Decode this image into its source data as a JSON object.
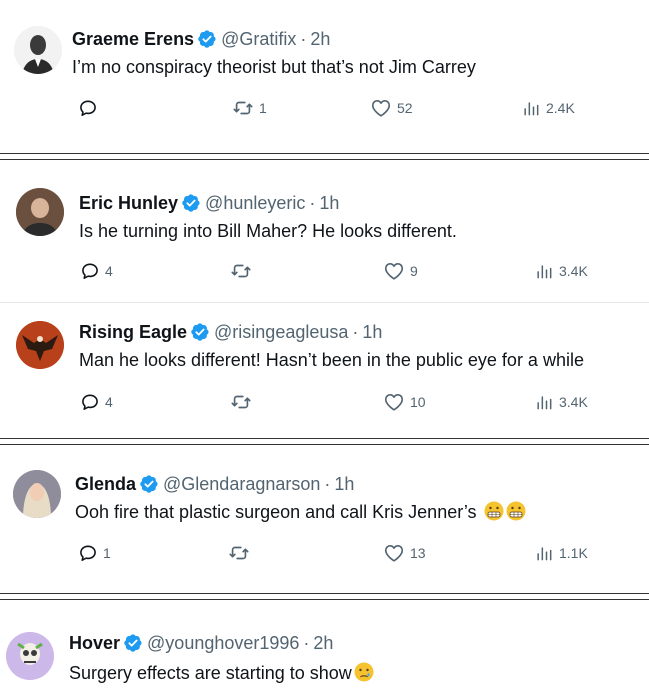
{
  "tweets": [
    {
      "name": "Graeme Erens",
      "handle": "@Gratifix",
      "time": "2h",
      "text": "I’m no conspiracy theorist but that’s not Jim Carrey",
      "replies": "",
      "reposts": "1",
      "likes": "52",
      "views": "2.4K",
      "avatar_color": "#d9d9d9"
    },
    {
      "name": "Eric Hunley",
      "handle": "@hunleyeric",
      "time": "1h",
      "text": "Is he turning into Bill Maher? He looks different.",
      "replies": "4",
      "reposts": "",
      "likes": "9",
      "views": "3.4K",
      "avatar_color": "#8a6a55"
    },
    {
      "name": "Rising Eagle",
      "handle": "@risingeagleusa",
      "time": "1h",
      "text": "Man he looks different! Hasn’t been in the public eye for a while",
      "replies": "4",
      "reposts": "",
      "likes": "10",
      "views": "3.4K",
      "avatar_color": "#c0441a"
    },
    {
      "name": "Glenda",
      "handle": "@Glendaragnarson",
      "time": "1h",
      "text": "Ooh fire that plastic surgeon and call Kris Jenner’s",
      "replies": "1",
      "reposts": "",
      "likes": "13",
      "views": "1.1K",
      "avatar_color": "#b9a7b4"
    },
    {
      "name": "Hover",
      "handle": "@younghover1996",
      "time": "2h",
      "text": "Surgery effects are starting to show",
      "avatar_color": "#c9b6e4"
    }
  ],
  "separator_dot": "·",
  "colors": {
    "verified": "#1d9bf0",
    "text_primary": "#0f1419",
    "text_secondary": "#536471"
  },
  "icons": {
    "reply": "reply-icon",
    "repost": "repost-icon",
    "like": "heart-icon",
    "views": "views-icon",
    "verified": "verified-badge-icon"
  }
}
